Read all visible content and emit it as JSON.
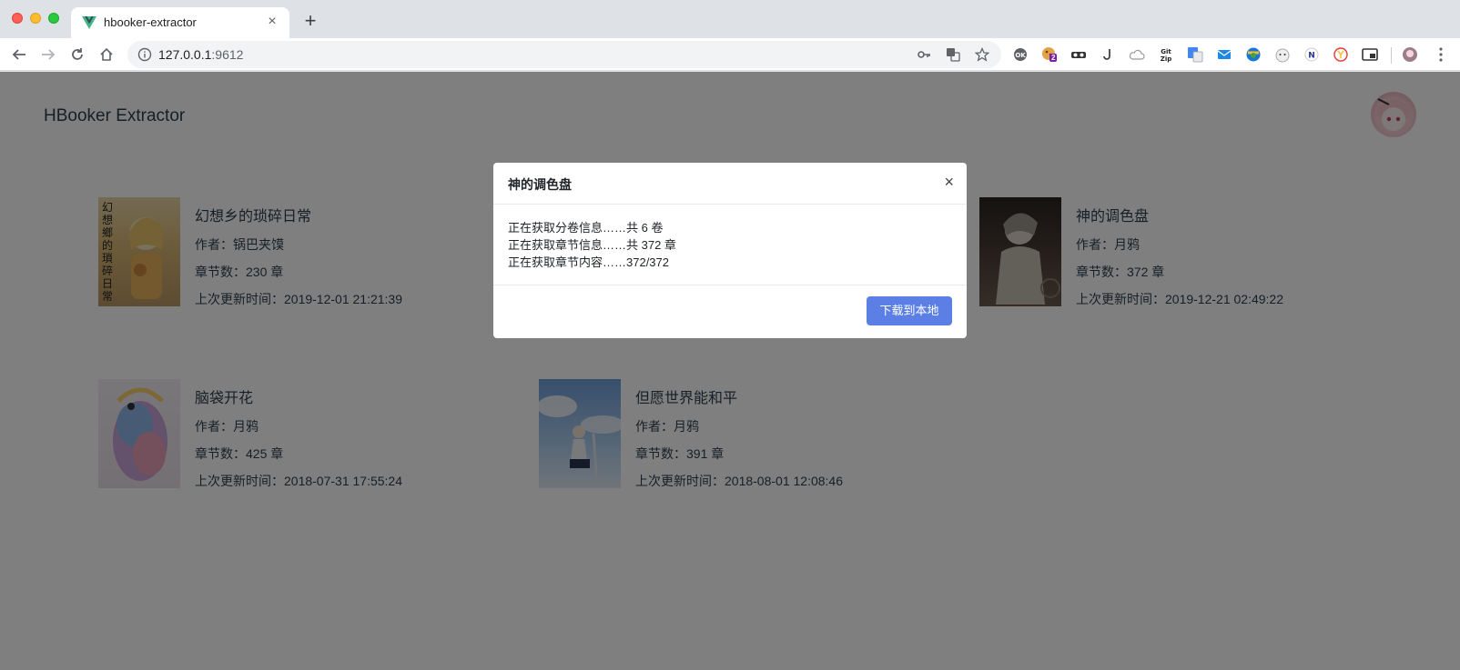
{
  "browser": {
    "tab_title": "hbooker-extractor",
    "tab_close": "×",
    "new_tab": "+",
    "url_host": "127.0.0.1",
    "url_port": ":9612",
    "extension_badge": "2"
  },
  "app": {
    "title": "HBooker Extractor"
  },
  "books": [
    {
      "name": "幻想乡的琐碎日常",
      "author": "作者：锅巴夹馍",
      "chapters": "章节数：230 章",
      "updated": "上次更新时间：2019-12-01 21:21:39",
      "cover_text": "幻想鄉的瑣碎日常"
    },
    {
      "name": "神的调色盘",
      "author": "作者：月鸦",
      "chapters": "章节数：372 章",
      "updated": "上次更新时间：2019-12-21 02:49:22"
    },
    {
      "name": "脑袋开花",
      "author": "作者：月鸦",
      "chapters": "章节数：425 章",
      "updated": "上次更新时间：2018-07-31 17:55:24"
    },
    {
      "name": "但愿世界能和平",
      "author": "作者：月鸦",
      "chapters": "章节数：391 章",
      "updated": "上次更新时间：2018-08-01 12:08:46"
    }
  ],
  "modal": {
    "title": "神的调色盘",
    "close": "×",
    "progress_lines": [
      "正在获取分卷信息……共 6 卷",
      "正在获取章节信息……共 372 章",
      "正在获取章节内容……372/372"
    ],
    "download_label": "下载到本地"
  },
  "colors": {
    "accent": "#5c7fe6",
    "text": "#2c3e50"
  }
}
